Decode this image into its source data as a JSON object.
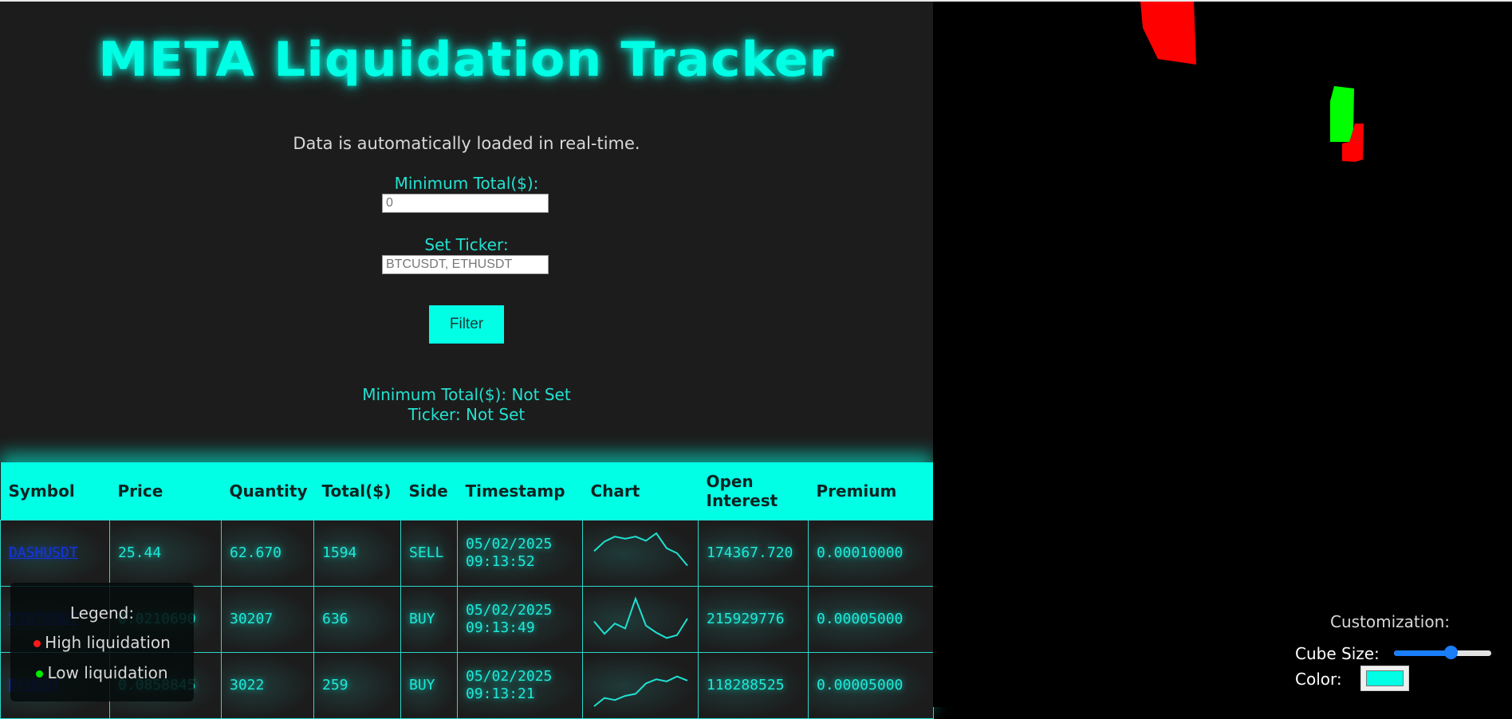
{
  "header": {
    "title": "META Liquidation Tracker",
    "subtitle": "Data is automatically loaded in real-time."
  },
  "filters": {
    "min_total_label": "Minimum Total($):",
    "min_total_placeholder": "0",
    "min_total_value": "",
    "ticker_label": "Set Ticker:",
    "ticker_placeholder": "BTCUSDT, ETHUSDT",
    "ticker_value": "",
    "filter_button": "Filter"
  },
  "status": {
    "min_total": "Minimum Total($): Not Set",
    "ticker": "Ticker: Not Set"
  },
  "table": {
    "columns": [
      "Symbol",
      "Price",
      "Quantity",
      "Total($)",
      "Side",
      "Timestamp",
      "Chart",
      "Open Interest",
      "Premium"
    ],
    "rows": [
      {
        "symbol": "DASHUSDT",
        "price": "25.44",
        "quantity": "62.670",
        "total": "1594",
        "side": "SELL",
        "date": "05/02/2025",
        "time": "09:13:52",
        "chart": [
          0.55,
          0.78,
          0.9,
          0.85,
          0.9,
          0.8,
          0.98,
          0.62,
          0.5,
          0.2
        ],
        "open_interest": "174367.720",
        "premium": "0.00010000"
      },
      {
        "symbol": "VIDTUSDT",
        "price": "0.0210690",
        "quantity": "30207",
        "total": "636",
        "side": "BUY",
        "date": "05/02/2025",
        "time": "09:13:49",
        "chart": [
          0.45,
          0.15,
          0.4,
          0.28,
          1.0,
          0.35,
          0.18,
          0.05,
          0.12,
          0.52
        ],
        "open_interest": "215929776",
        "premium": "0.00005000"
      },
      {
        "symbol": "DFUSDT",
        "price": "0.0858845",
        "quantity": "3022",
        "total": "259",
        "side": "BUY",
        "date": "05/02/2025",
        "time": "09:13:21",
        "chart": [
          0.0,
          0.2,
          0.15,
          0.25,
          0.3,
          0.55,
          0.65,
          0.6,
          0.72,
          0.62
        ],
        "open_interest": "118288525",
        "premium": "0.00005000"
      }
    ]
  },
  "legend": {
    "title": "Legend:",
    "items": [
      {
        "label": "High liquidation",
        "color": "#ff1a1a"
      },
      {
        "label": "Low liquidation",
        "color": "#00ee00"
      }
    ]
  },
  "customization": {
    "title": "Customization:",
    "cube_size_label": "Cube Size:",
    "cube_size_value": 0.6,
    "color_label": "Color:",
    "color_value": "#00ffe5"
  },
  "colors": {
    "accent": "#00ffe5",
    "high": "#ff0000",
    "low": "#00ff00"
  }
}
